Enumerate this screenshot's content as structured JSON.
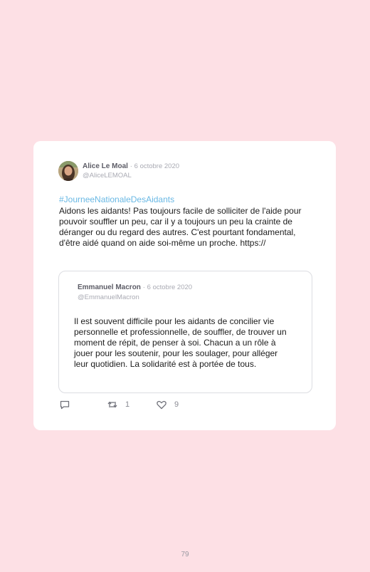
{
  "tweet": {
    "author_name": "Alice Le Moal",
    "separator": "·",
    "date": "6 octobre 2020",
    "handle": "@AliceLEMOAL",
    "hashtag": "#JourneeNationaleDesAidants",
    "text": "Aidons les aidants! Pas toujours facile de solliciter de l'aide pour pouvoir souffler un peu, car il y a toujours un peu la crainte de déranger ou du regard des autres. C'est pourtant fondamental, d'être aidé quand on aide soi-même un proche. https://"
  },
  "quoted_tweet": {
    "author_name": "Emmanuel Macron",
    "separator": "·",
    "date": "6 octobre 2020",
    "handle": "@EmmanuelMacron",
    "text": "Il est souvent difficile pour les aidants de concilier vie personnelle et professionnelle, de souffler, de trouver un moment de répit, de penser à soi. Chacun a un rôle à jouer pour les soutenir, pour les soulager, pour alléger leur quotidien. La solidarité est à portée de tous."
  },
  "actions": {
    "reply_icon": "reply-icon",
    "retweet_icon": "retweet-icon",
    "retweet_count": "1",
    "like_icon": "heart-icon",
    "like_count": "9"
  },
  "colors": {
    "page_background": "#fde0e5",
    "hashtag": "#69b8e4",
    "muted": "#a9aab3"
  },
  "page": {
    "number": "79"
  }
}
